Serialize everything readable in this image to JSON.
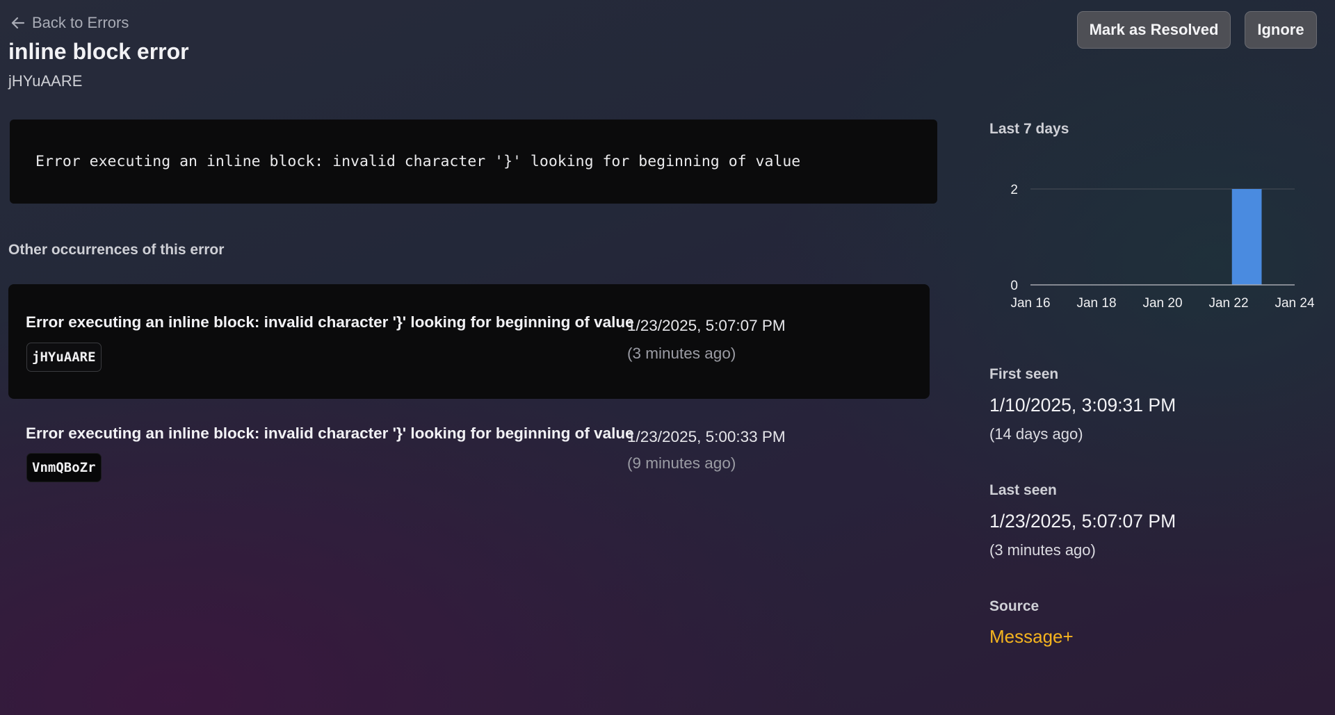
{
  "header": {
    "back_label": "Back to Errors",
    "title": "inline block error",
    "error_id": "jHYuAARE",
    "actions": {
      "resolve_label": "Mark as Resolved",
      "ignore_label": "Ignore"
    }
  },
  "error": {
    "message": "Error executing an inline block: invalid character '}' looking for beginning of value"
  },
  "occurrences": {
    "title": "Other occurrences of this error",
    "items": [
      {
        "message": "Error executing an inline block: invalid character '}' looking for beginning of value",
        "id": "jHYuAARE",
        "date": "1/23/2025, 5:07:07 PM",
        "ago": "(3 minutes ago)"
      },
      {
        "message": "Error executing an inline block: invalid character '}' looking for beginning of value",
        "id": "VnmQBoZr",
        "date": "1/23/2025, 5:00:33 PM",
        "ago": "(9 minutes ago)"
      }
    ]
  },
  "sidebar": {
    "chart_title": "Last 7 days",
    "first_seen": {
      "label": "First seen",
      "date": "1/10/2025, 3:09:31 PM",
      "ago": "(14 days ago)"
    },
    "last_seen": {
      "label": "Last seen",
      "date": "1/23/2025, 5:07:07 PM",
      "ago": "(3 minutes ago)"
    },
    "source": {
      "label": "Source",
      "value": "Message+"
    }
  },
  "colors": {
    "bar": "#4a8be0",
    "source_link": "#f5b41f",
    "code_block_bg": "#0b0b0c"
  },
  "chart_data": {
    "type": "bar",
    "title": "Last 7 days",
    "x": [
      "Jan 22"
    ],
    "values": [
      2
    ],
    "x_tick_labels": [
      "Jan 16",
      "Jan 18",
      "Jan 20",
      "Jan 22",
      "Jan 24"
    ],
    "x_range": [
      "Jan 16",
      "Jan 24"
    ],
    "y_tick_labels": [
      "0",
      "2"
    ],
    "ylim": [
      0,
      2
    ],
    "grid": true,
    "legend": "none"
  }
}
